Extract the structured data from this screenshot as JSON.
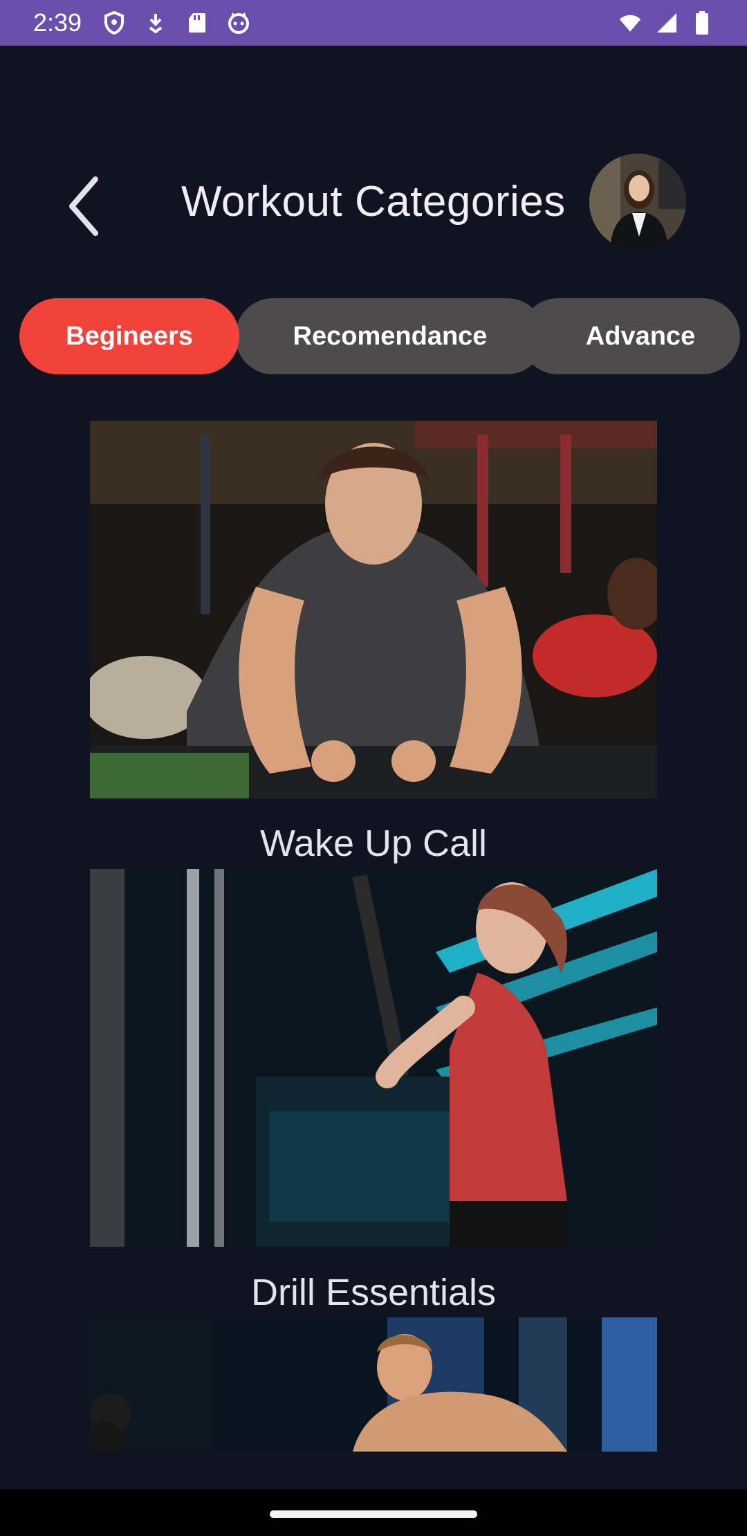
{
  "status_bar": {
    "time": "2:39",
    "icons_left": [
      "shield-icon",
      "download-icon",
      "sd-card-icon",
      "cat-icon"
    ],
    "icons_right": [
      "wifi-icon",
      "signal-icon",
      "battery-icon"
    ]
  },
  "header": {
    "title": "Workout Categories",
    "back_icon": "chevron-left-icon",
    "avatar": "profile-avatar"
  },
  "tabs": [
    {
      "label": "Begineers",
      "active": true
    },
    {
      "label": "Recomendance",
      "active": false
    },
    {
      "label": "Advance",
      "active": false
    }
  ],
  "workouts": [
    {
      "title": ""
    },
    {
      "title": "Wake Up Call"
    },
    {
      "title": "Drill Essentials"
    }
  ],
  "colors": {
    "background": "#0f1322",
    "status_bar": "#6a4fae",
    "active_tab": "#f2433a",
    "inactive_tab": "#4d4b4c"
  }
}
